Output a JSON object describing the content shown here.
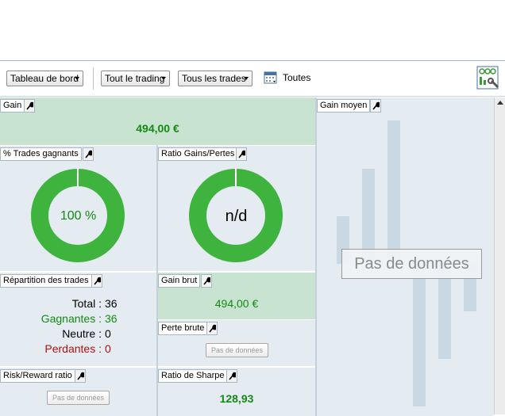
{
  "toolbar": {
    "dashboard_label": "Tableau de bord",
    "trading_filter_label": "Tout le trading",
    "trades_filter_label": "Tous les trades",
    "period_label": "Toutes"
  },
  "panels": {
    "gain": {
      "title": "Gain",
      "value": "494,00 €"
    },
    "win_pct": {
      "title": "% Trades gagnants",
      "center_text": "100 %",
      "fraction": 1.0
    },
    "ratio_gp": {
      "title": "Ratio Gains/Pertes",
      "center_text": "n/d",
      "fraction": 1.0
    },
    "avg_gain": {
      "title": "Gain moyen",
      "no_data": "Pas de données"
    },
    "distribution": {
      "title": "Répartition des trades",
      "total_label": "Total :",
      "total_value": "36",
      "win_label": "Gagnantes :",
      "win_value": "36",
      "neutral_label": "Neutre :",
      "neutral_value": "0",
      "loss_label": "Perdantes :",
      "loss_value": "0"
    },
    "gross_gain": {
      "title": "Gain brut",
      "value": "494,00 €"
    },
    "gross_loss": {
      "title": "Perte brute",
      "no_data": "Pas de données"
    },
    "risk_reward": {
      "title": "Risk/Reward ratio",
      "no_data": "Pas de données"
    },
    "sharpe": {
      "title": "Ratio de Sharpe",
      "value": "128,93"
    }
  },
  "colors": {
    "donut_green": "#3eb33e",
    "profit_green": "#138a13",
    "loss_red": "#b01010",
    "panel_bg": "#e4ecf2",
    "highlight_bg": "#c8e3d0"
  },
  "icons": [
    "wrench-icon",
    "calendar-icon",
    "dashboard-config-icon"
  ]
}
